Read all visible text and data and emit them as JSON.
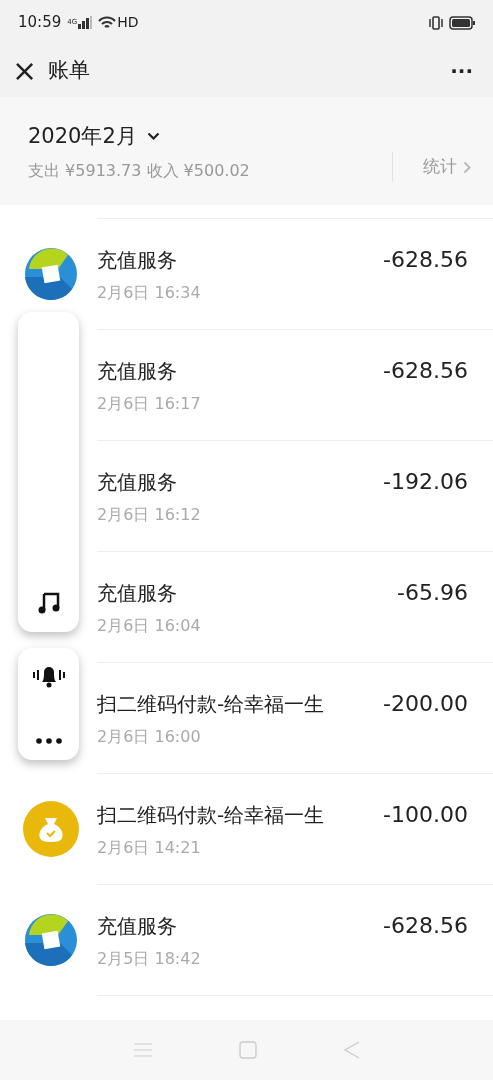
{
  "status_bar": {
    "time": "10:59",
    "network": "4G",
    "hd": "HD"
  },
  "header": {
    "close": "×",
    "title": "账单",
    "more": "···"
  },
  "summary": {
    "month": "2020年2月",
    "totals": "支出 ¥5913.73 收入 ¥500.02",
    "stats": "统计"
  },
  "bills": [
    {
      "kind": "service",
      "title": "充值服务",
      "time": "2月6日 16:34",
      "amount": "-628.56"
    },
    {
      "title": "充值服务",
      "time": "2月6日 16:17",
      "amount": "-628.56"
    },
    {
      "title": "充值服务",
      "time": "2月6日 16:12",
      "amount": "-192.06"
    },
    {
      "title": "充值服务",
      "time": "2月6日 16:04",
      "amount": "-65.96"
    },
    {
      "title": "扫二维码付款-给幸福一生",
      "time": "2月6日 16:00",
      "amount": "-200.00"
    },
    {
      "kind": "payment",
      "title": "扫二维码付款-给幸福一生",
      "time": "2月6日 14:21",
      "amount": "-100.00"
    },
    {
      "kind": "service",
      "title": "充值服务",
      "time": "2月5日 18:42",
      "amount": "-628.56"
    }
  ]
}
